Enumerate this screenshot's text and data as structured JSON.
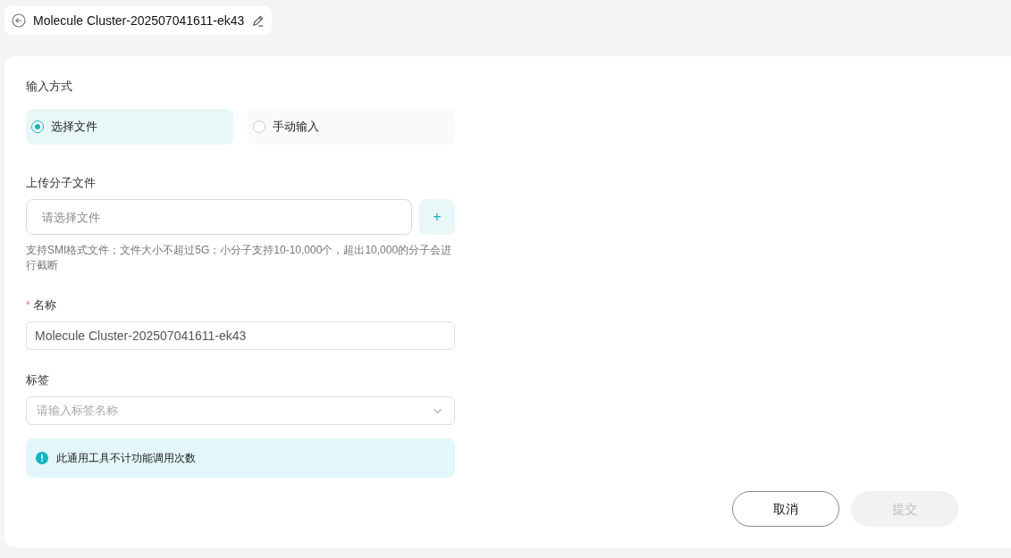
{
  "header": {
    "title": "Molecule Cluster-202507041611-ek43"
  },
  "form": {
    "input_method": {
      "label": "输入方式",
      "options": [
        {
          "label": "选择文件",
          "selected": true
        },
        {
          "label": "手动输入",
          "selected": false
        }
      ]
    },
    "upload": {
      "label": "上传分子文件",
      "placeholder": "请选择文件",
      "add_button": "+",
      "hint": "支持SMI格式文件；文件大小不超过5G；小分子支持10-10,000个，超出10,000的分子会进行截断"
    },
    "name": {
      "label": "名称",
      "required_mark": "*",
      "value": "Molecule Cluster-202507041611-ek43"
    },
    "tags": {
      "label": "标签",
      "placeholder": "请输入标签名称"
    },
    "notice": "此通用工具不计功能调用次数"
  },
  "buttons": [
    {
      "label": "取消",
      "disabled": false
    },
    {
      "label": "提交",
      "disabled": true
    }
  ]
}
